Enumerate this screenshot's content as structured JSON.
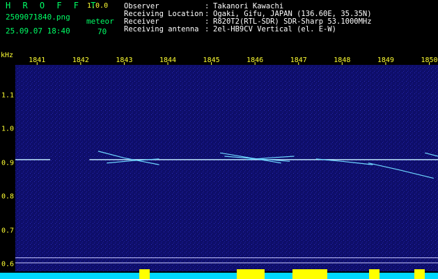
{
  "header": {
    "title": "H R O F F T",
    "version": "1.0.0",
    "filename": "2509071840.png",
    "datetime": "25.09.07 18:40",
    "detection_label": "meteor",
    "detection_count": "70"
  },
  "info": [
    {
      "label": "Observer",
      "value": "Takanori Kawachi"
    },
    {
      "label": "Receiving Location",
      "value": "Ogaki, Gifu, JAPAN (136.60E, 35.35N)"
    },
    {
      "label": "Receiver",
      "value": "R820T2(RTL-SDR) SDR-Sharp 53.1000MHz"
    },
    {
      "label": "Receiving antenna",
      "value": "2el-HB9CV Vertical (el. E-W)"
    }
  ],
  "colors": {
    "header_text": "#00ff66",
    "info_text": "#ffffff",
    "axis_text": "#ffff33",
    "background": "#000000",
    "spectrogram_bg": "#0e0e6a",
    "carrier_line": "#bfe8ff",
    "bottom_level": "#00d8ff",
    "bottom_peak": "#ffff00"
  },
  "chart_data": {
    "type": "heatmap",
    "xlabel": "",
    "ylabel": "kHz",
    "x_ticks": [
      "1841",
      "1842",
      "1843",
      "1844",
      "1845",
      "1846",
      "1847",
      "1848",
      "1849",
      "1850"
    ],
    "x_range": [
      1840.5,
      1850.2
    ],
    "y_ticks": [
      "1.1",
      "1.0",
      "0.9",
      "0.8",
      "0.7",
      "0.6"
    ],
    "y_range": [
      0.58,
      1.19
    ],
    "carrier_khz": 0.91,
    "carrier_segments": [
      [
        1840.5,
        1841.3
      ],
      [
        1842.2,
        1850.2
      ]
    ],
    "meteor_traces": [
      {
        "x": [
          1842.4,
          1843.0,
          1843.8
        ],
        "y": [
          0.935,
          0.915,
          0.895
        ]
      },
      {
        "x": [
          1842.6,
          1843.2,
          1843.8
        ],
        "y": [
          0.9,
          0.907,
          0.912
        ]
      },
      {
        "x": [
          1845.2,
          1845.9,
          1846.6
        ],
        "y": [
          0.93,
          0.915,
          0.9
        ]
      },
      {
        "x": [
          1845.3,
          1846.0,
          1846.8
        ],
        "y": [
          0.92,
          0.913,
          0.905
        ]
      },
      {
        "x": [
          1845.8,
          1846.3,
          1846.9
        ],
        "y": [
          0.91,
          0.915,
          0.92
        ]
      },
      {
        "x": [
          1847.4,
          1848.0,
          1848.7
        ],
        "y": [
          0.912,
          0.905,
          0.895
        ]
      },
      {
        "x": [
          1848.6,
          1849.3,
          1850.1
        ],
        "y": [
          0.9,
          0.88,
          0.855
        ]
      },
      {
        "x": [
          1849.9,
          1850.2
        ],
        "y": [
          0.93,
          0.92
        ]
      }
    ],
    "reference_lines_khz": [
      0.62,
      0.605
    ]
  }
}
